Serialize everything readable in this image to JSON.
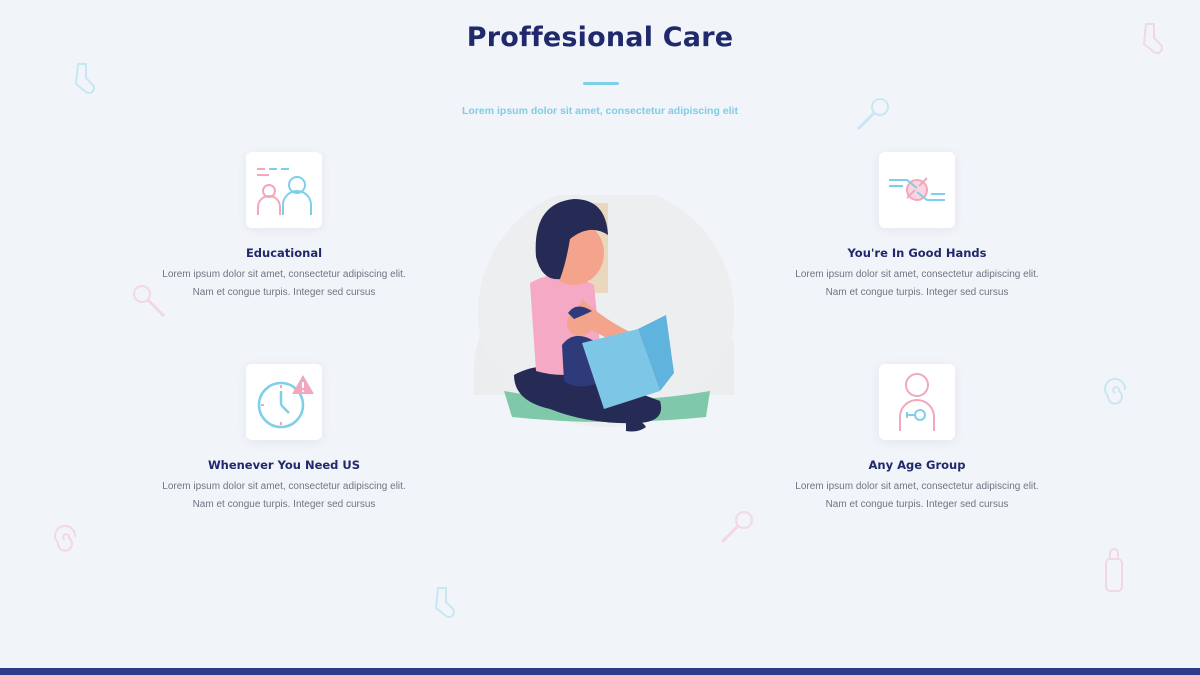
{
  "section": {
    "title": "Proffesional Care",
    "subtitle": "Lorem ipsum dolor sit amet, consectetur adipiscing elit"
  },
  "features": [
    {
      "icon": "educational-people-icon",
      "title": "Educational",
      "text_line1": "Lorem ipsum dolor sit amet, consectetur adipiscing elit.",
      "text_line2": "Nam et congue turpis. Integer sed cursus"
    },
    {
      "icon": "handshake-icon",
      "title": "You're In Good Hands",
      "text_line1": "Lorem ipsum dolor sit amet, consectetur adipiscing elit.",
      "text_line2": "Nam et congue turpis. Integer sed cursus"
    },
    {
      "icon": "clock-alert-icon",
      "title": "Whenever You Need US",
      "text_line1": "Lorem ipsum dolor sit amet, consectetur adipiscing elit.",
      "text_line2": "Nam et congue turpis. Integer sed cursus"
    },
    {
      "icon": "baby-pacifier-icon",
      "title": "Any Age Group",
      "text_line1": "Lorem ipsum dolor sit amet, consectetur adipiscing elit.",
      "text_line2": "Nam et congue turpis. Integer sed cursus"
    }
  ],
  "hero": {
    "icon": "mother-reading-with-child-illustration"
  },
  "colors": {
    "navy": "#20296b",
    "accent_blue": "#7dd0e8",
    "accent_pink": "#f2a7bd",
    "background": "#f1f4f9",
    "bottom_bar": "#2e3a8c"
  }
}
